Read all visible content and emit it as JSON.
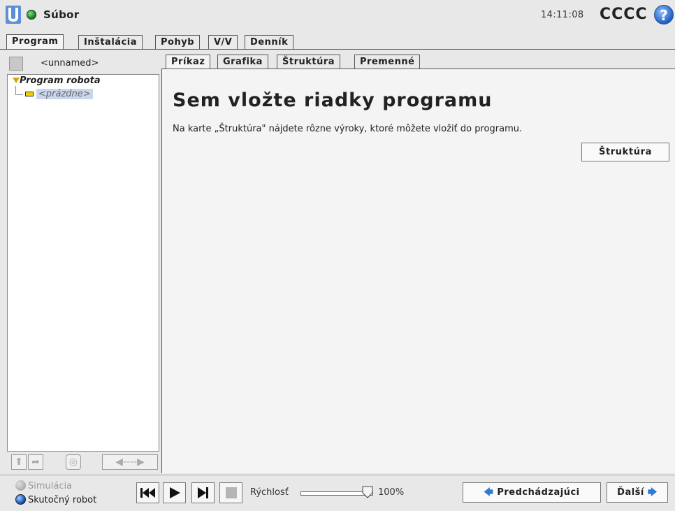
{
  "header": {
    "file_menu": "Súbor",
    "clock": "14:11:08",
    "robot_name": "CCCC",
    "help_glyph": "?"
  },
  "main_tabs": [
    {
      "label": "Program",
      "active": true
    },
    {
      "label": "Inštalácia",
      "active": false
    },
    {
      "label": "Pohyb",
      "active": false
    },
    {
      "label": "V/V",
      "active": false
    },
    {
      "label": "Denník",
      "active": false
    }
  ],
  "program_panel": {
    "program_name": "<unnamed>",
    "tree_root": "Program robota",
    "tree_empty": "<prázdne>"
  },
  "sub_tabs": [
    {
      "label": "Príkaz",
      "active": true
    },
    {
      "label": "Grafika",
      "active": false
    },
    {
      "label": "Štruktúra",
      "active": false
    },
    {
      "label": "Premenné",
      "active": false
    }
  ],
  "content": {
    "headline": "Sem vložte riadky programu",
    "subtitle": "Na karte „Štruktúra\" nájdete rôzne výroky, ktoré môžete vložiť do programu.",
    "structure_button": "Štruktúra"
  },
  "footer": {
    "simulation_label": "Simulácia",
    "real_robot_label": "Skutočný robot",
    "speed_label": "Rýchlosť",
    "speed_value": "100%",
    "speed_fraction": 1.0,
    "prev_label": "Predchádzajúci",
    "next_label": "Ďalší"
  },
  "colors": {
    "accent_blue": "#2e7bd6",
    "status_green": "#1f8a1f",
    "selection": "#c9d7ee",
    "tree_arrow": "#d9a300"
  }
}
